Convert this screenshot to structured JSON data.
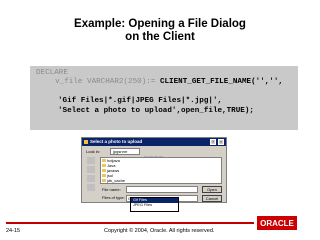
{
  "slide": {
    "title_line1": "Example: Opening a File Dialog",
    "title_line2": "on the Client"
  },
  "code": {
    "line1": "DECLARE",
    "line2_prefix": "  v_file VARCHAR2(250):= ",
    "line2_call": "CLIENT_GET_FILE_NAME('','',",
    "line3": "'Gif Files|*.gif|JPEG Files|*.jpg|',",
    "line4": "'Select a photo to upload',open_file,TRUE);"
  },
  "dialog": {
    "title": "Select a photo to upload",
    "look_in_label": "Look in:",
    "look_in_value": "jpgsnmr",
    "files": [
      "hotjava",
      "Java",
      "javaws",
      "jsol",
      "jdk_cache"
    ],
    "file_name_label": "File name:",
    "file_name_value": "",
    "files_of_type_label": "Files of type:",
    "files_of_type_value": "Gif Files",
    "open_label": "Open",
    "cancel_label": "Cancel",
    "type_options": [
      "Gif Files",
      "JPEG Files"
    ]
  },
  "footer": {
    "page_number": "24-15",
    "copyright": "Copyright © 2004, Oracle.  All rights reserved.",
    "logo_text": "ORACLE"
  },
  "colors": {
    "oracle_red": "#cc0000",
    "code_bg": "#c9c9c9",
    "titlebar": "#0a246a"
  }
}
